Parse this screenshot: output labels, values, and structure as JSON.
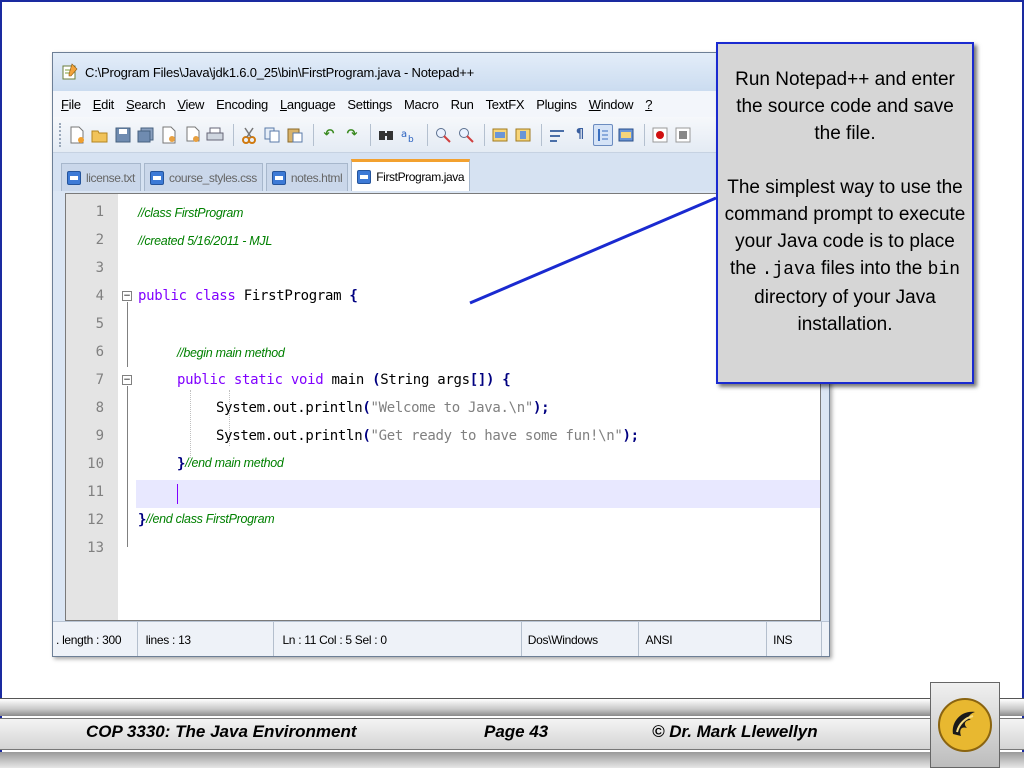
{
  "window": {
    "title": "C:\\Program Files\\Java\\jdk1.6.0_25\\bin\\FirstProgram.java - Notepad++"
  },
  "menu": [
    {
      "label": "File",
      "ul": "F",
      "rest": "ile"
    },
    {
      "label": "Edit",
      "ul": "E",
      "rest": "dit"
    },
    {
      "label": "Search",
      "ul": "S",
      "rest": "earch"
    },
    {
      "label": "View",
      "ul": "V",
      "rest": "iew"
    },
    {
      "label": "Encoding",
      "ul": "",
      "rest": "Encoding"
    },
    {
      "label": "Language",
      "ul": "L",
      "rest": "anguage"
    },
    {
      "label": "Settings",
      "ul": "",
      "rest": "Settings"
    },
    {
      "label": "Macro",
      "ul": "",
      "rest": "Macro"
    },
    {
      "label": "Run",
      "ul": "",
      "rest": "Run"
    },
    {
      "label": "TextFX",
      "ul": "",
      "rest": "TextFX"
    },
    {
      "label": "Plugins",
      "ul": "",
      "rest": "Plugins"
    },
    {
      "label": "Window",
      "ul": "W",
      "rest": "indow"
    },
    {
      "label": "?",
      "ul": "?",
      "rest": ""
    }
  ],
  "tabs": [
    {
      "label": "license.txt",
      "active": false
    },
    {
      "label": "course_styles.css",
      "active": false
    },
    {
      "label": "notes.html",
      "active": false
    },
    {
      "label": "FirstProgram.java",
      "active": true
    }
  ],
  "code_lines": [
    {
      "n": "1",
      "text": "//class FirstProgram"
    },
    {
      "n": "2",
      "text": "//created 5/16/2011 - MJL"
    },
    {
      "n": "3",
      "text": ""
    },
    {
      "n": "4",
      "text": "public class FirstProgram {"
    },
    {
      "n": "5",
      "text": ""
    },
    {
      "n": "6",
      "text": "//begin main method"
    },
    {
      "n": "7",
      "text": "public static void main (String args[]) {"
    },
    {
      "n": "8",
      "text": "System.out.println(\"Welcome to Java.\\n\");"
    },
    {
      "n": "9",
      "text": "System.out.println(\"Get ready to have some fun!\\n\");"
    },
    {
      "n": "10",
      "text": "}//end main method"
    },
    {
      "n": "11",
      "text": ""
    },
    {
      "n": "12",
      "text": "}//end class FirstProgram"
    },
    {
      "n": "13",
      "text": ""
    }
  ],
  "tokens": {
    "public": "public",
    "class": "class",
    "static": "static",
    "void": "void",
    "main": "main",
    "first_program": "FirstProgram",
    "open_brace": "{",
    "close_brace": "}",
    "open_paren": "(",
    "close_paren_semi": ");",
    "main_params_open": "(",
    "string_args": "String args",
    "brackets_close": "[])",
    "println_call": "System.out.println",
    "str_welcome": "\"Welcome to Java.\\n\"",
    "str_fun": "\"Get ready to have some fun!\\n\"",
    "comment_end_main": "//end main method",
    "comment_end_class": "//end class FirstProgram"
  },
  "status": {
    "length": ". length : 300",
    "lines": "lines : 13",
    "position": "Ln : 11    Col : 5    Sel : 0",
    "eol": "Dos\\Windows",
    "encoding": "ANSI",
    "mode": "INS"
  },
  "callout": {
    "para1": "Run Notepad++ and enter the source code and save the file.",
    "para2_a": "The simplest way to use the command prompt to execute your Java code is to place the",
    "para2_code1": ".java",
    "para2_b": "files into the",
    "para2_code2": "bin",
    "para2_c": "directory of your Java installation."
  },
  "footer": {
    "course": "COP 3330:  The Java Environment",
    "page": "Page 43",
    "author": "© Dr. Mark Llewellyn"
  },
  "colors": {
    "keyword": "#8000ff",
    "comment": "#008000",
    "string": "#808080",
    "operator": "#000080",
    "callout_border": "#1a2ad0",
    "current_line": "#e8e8ff"
  }
}
